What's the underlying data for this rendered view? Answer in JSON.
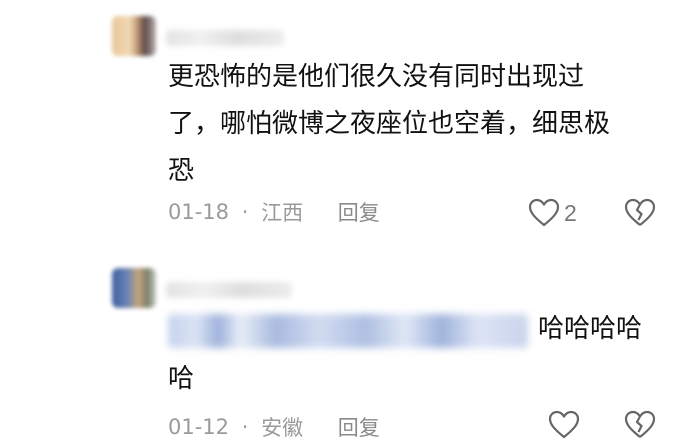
{
  "comments": [
    {
      "text_lines": [
        "更恐怖的是他们很久没有同时出现过",
        "了，哪怕微博之夜座位也空着，细思极",
        "恐"
      ],
      "date": "01-18",
      "location": "江西",
      "reply_label": "回复",
      "like_count": "2"
    },
    {
      "text_lines": [
        "哈哈哈哈",
        "哈"
      ],
      "date": "01-12",
      "location": "安徽",
      "reply_label": "回复",
      "like_count": ""
    }
  ],
  "separator": "·",
  "icons": [
    "heart-icon",
    "broken-heart-icon"
  ],
  "colors": {
    "text": "#111111",
    "meta": "#9a9a9a",
    "icon": "#666666"
  }
}
